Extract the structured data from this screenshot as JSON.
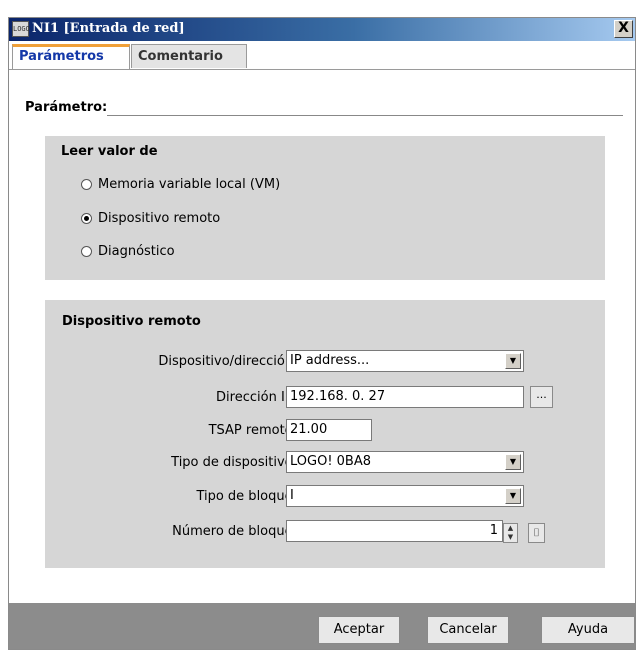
{
  "window": {
    "title": "NI1 [Entrada de red]",
    "icon_text": "LOGO",
    "close_label": "X"
  },
  "tabs": [
    {
      "label": "Parámetros",
      "active": true
    },
    {
      "label": "Comentario",
      "active": false
    }
  ],
  "section": {
    "label": "Parámetro:"
  },
  "read_value": {
    "title": "Leer valor de",
    "options": [
      {
        "label": "Memoria variable local (VM)",
        "checked": false
      },
      {
        "label": "Dispositivo remoto",
        "checked": true
      },
      {
        "label": "Diagnóstico",
        "checked": false
      }
    ]
  },
  "remote_device": {
    "title": "Dispositivo remoto",
    "device_address_label": "Dispositivo/direcció...",
    "device_address_value": "IP address...",
    "ip_label": "Dirección IP:",
    "ip_value": "192.168.  0. 27",
    "browse_label": "...",
    "tsap_label": "TSAP remoto:",
    "tsap_value": "21.00",
    "device_type_label": "Tipo de dispositivo:",
    "device_type_value": "LOGO! 0BA8",
    "block_type_label": "Tipo de bloque:",
    "block_type_value": "I",
    "block_number_label": "Número de bloque:",
    "block_number_value": "1"
  },
  "buttons": {
    "ok": "Aceptar",
    "cancel": "Cancelar",
    "help": "Ayuda"
  }
}
